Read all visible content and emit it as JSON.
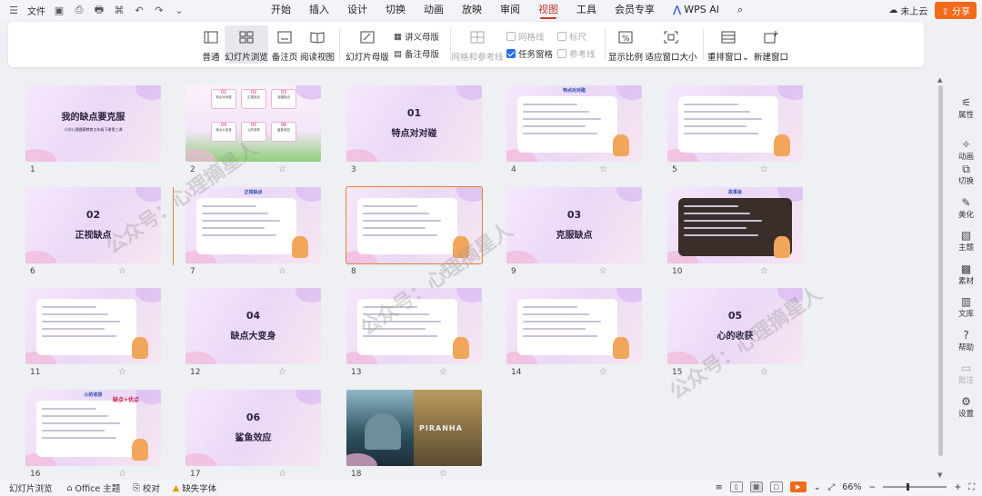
{
  "titlebar": {
    "file_label": "文件",
    "menu": [
      "开始",
      "插入",
      "设计",
      "切换",
      "动画",
      "放映",
      "审阅",
      "视图",
      "工具",
      "会员专享"
    ],
    "active_menu": "视图",
    "wps_ai": "WPS AI",
    "cloud_label": "未上云",
    "share_label": "分享"
  },
  "ribbon": {
    "normal": "普通",
    "slide_sorter": "幻灯片浏览",
    "notes_page": "备注页",
    "reading_view": "阅读视图",
    "slide_master": "幻灯片母版",
    "handout_master": "讲义母版",
    "notes_master": "备注母版",
    "grid_guides": "网格和参考线",
    "gridlines": "网格线",
    "ruler": "标尺",
    "task_pane": "任务窗格",
    "guides": "参考线",
    "zoom": "显示比例",
    "fit_window": "适应窗口大小",
    "arrange_window": "重排窗口",
    "new_window": "新建窗口"
  },
  "slides": [
    {
      "num": "1",
      "title": "我的缺点要克服",
      "sub": "小学心理健康教育五年级下册第三课"
    },
    {
      "num": "2",
      "items": [
        "01",
        "02",
        "03",
        "04",
        "05",
        "06"
      ],
      "labels": [
        "特点对对碰",
        "正视缺点",
        "克服缺点",
        "缺点大变身",
        "心的收获",
        "鲨鱼效应"
      ]
    },
    {
      "num": "3",
      "big": "01",
      "title": "特点对对碰"
    },
    {
      "num": "4",
      "head": "特点对对碰"
    },
    {
      "num": "5"
    },
    {
      "num": "6",
      "big": "02",
      "title": "正视缺点"
    },
    {
      "num": "7",
      "head": "正视缺点"
    },
    {
      "num": "8"
    },
    {
      "num": "9",
      "big": "03",
      "title": "克服缺点"
    },
    {
      "num": "10",
      "head": "故事会"
    },
    {
      "num": "11"
    },
    {
      "num": "12",
      "big": "04",
      "title": "缺点大变身"
    },
    {
      "num": "13"
    },
    {
      "num": "14"
    },
    {
      "num": "15",
      "big": "05",
      "title": "心的收获"
    },
    {
      "num": "16",
      "head": "心的收获",
      "box": "缺点+优点"
    },
    {
      "num": "17",
      "big": "06",
      "title": "鲨鱼效应"
    },
    {
      "num": "18",
      "poster": "PIRANHA"
    }
  ],
  "sidebar": [
    "属性",
    "动画",
    "切换",
    "美化",
    "主题",
    "素材",
    "文库",
    "帮助",
    "批注",
    "设置"
  ],
  "statusbar": {
    "view": "幻灯片浏览",
    "theme": "Office 主题",
    "proof": "校对",
    "missing_font": "缺失字体",
    "zoom": "66%"
  },
  "watermark": "公众号：心理摘星人",
  "colors": {
    "accent": "#c0392b",
    "share": "#f26b1d",
    "check": "#2b6de8"
  }
}
